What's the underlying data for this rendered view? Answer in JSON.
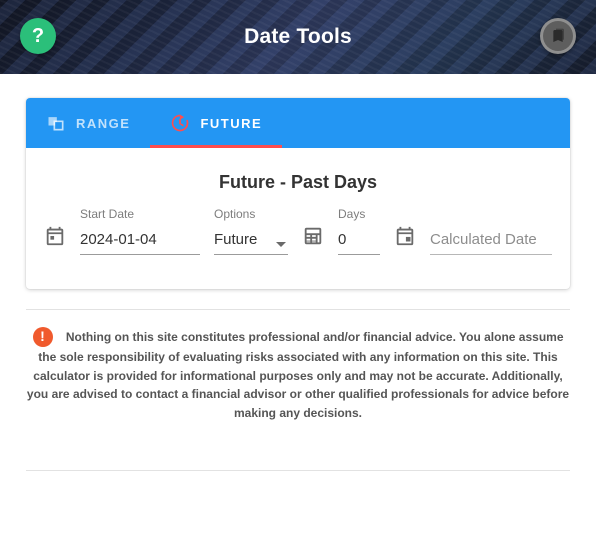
{
  "header": {
    "title": "Date Tools",
    "help_symbol": "?"
  },
  "tabs": {
    "range": {
      "label": "RANGE"
    },
    "future": {
      "label": "FUTURE"
    }
  },
  "section": {
    "title": "Future - Past Days"
  },
  "fields": {
    "start_date": {
      "label": "Start Date",
      "value": "2024-01-04"
    },
    "options": {
      "label": "Options",
      "value": "Future"
    },
    "days": {
      "label": "Days",
      "value": "0"
    },
    "result": {
      "placeholder": "Calculated Date"
    }
  },
  "disclaimer": {
    "text": "Nothing on this site constitutes professional and/or financial advice. You alone assume the sole responsibility of evaluating risks associated with any information on this site. This calculator is provided for informational purposes only and may not be accurate. Additionally, you are advised to contact a financial advisor or other qualified professionals for advice before making any decisions.",
    "symbol": "!"
  }
}
